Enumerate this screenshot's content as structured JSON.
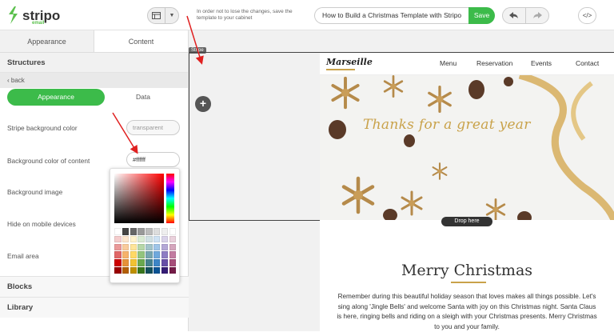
{
  "app": {
    "logo_text": "stripo",
    "logo_sub": "email",
    "notice": "In order not to lose the changes, save the template to your cabinet",
    "template_title": "How to Build a Christmas Template with Stripo",
    "save_label": "Save",
    "code_label": "</>"
  },
  "sidebar": {
    "tabs": [
      "Appearance",
      "Content"
    ],
    "structures_title": "Structures",
    "back_label": "‹ back",
    "toggle": {
      "appearance": "Appearance",
      "data": "Data"
    },
    "props": {
      "stripe_bg": "Stripe background color",
      "stripe_bg_value": "transparent",
      "content_bg": "Background color of content",
      "content_bg_value": "#ffffff",
      "bg_image": "Background image",
      "hide_mobile": "Hide on mobile devices",
      "email_area": "Email area"
    },
    "blocks_title": "Blocks",
    "library_title": "Library"
  },
  "picker": {
    "swatches": [
      "#ffffff",
      "#444444",
      "#666666",
      "#999999",
      "#bbbbbb",
      "#dddddd",
      "#eeeeee",
      "#ffffff",
      "#f4cccc",
      "#fce5cd",
      "#fff2cc",
      "#d9ead3",
      "#d0e0e3",
      "#cfe2f3",
      "#d9d2e9",
      "#ead1dc",
      "#ea9999",
      "#f9cb9c",
      "#ffe599",
      "#b6d7a8",
      "#a2c4c9",
      "#9fc5e8",
      "#b4a7d6",
      "#d5a6bd",
      "#e06666",
      "#f6b26b",
      "#ffd966",
      "#93c47d",
      "#76a5af",
      "#6fa8dc",
      "#8e7cc3",
      "#c27ba0",
      "#cc0000",
      "#e69138",
      "#f1c232",
      "#6aa84f",
      "#45818e",
      "#3d85c6",
      "#674ea7",
      "#a64d79",
      "#990000",
      "#b45f06",
      "#bf9000",
      "#38761d",
      "#134f5c",
      "#0b5394",
      "#351c75",
      "#741b47"
    ]
  },
  "canvas": {
    "stripe_tag": "Stripe",
    "plus_label": "+",
    "drop_label": "Drop here",
    "email": {
      "brand": "Marseille",
      "nav": [
        "Menu",
        "Reservation",
        "Events",
        "Contact"
      ],
      "hero_text": "Thanks for a great year",
      "heading": "Merry Christmas",
      "body": "Remember during this beautiful holiday season that loves makes all things possible. Let's sing along 'Jingle Bells' and welcome Santa with joy on this Christmas night. Santa Claus is here, ringing bells and riding on a sleigh with your Christmas presents. Merry Christmas to you and your family."
    }
  },
  "colors": {
    "accent": "#3cbb4a",
    "gold": "#c9a24a",
    "annotation": "#e02020"
  }
}
